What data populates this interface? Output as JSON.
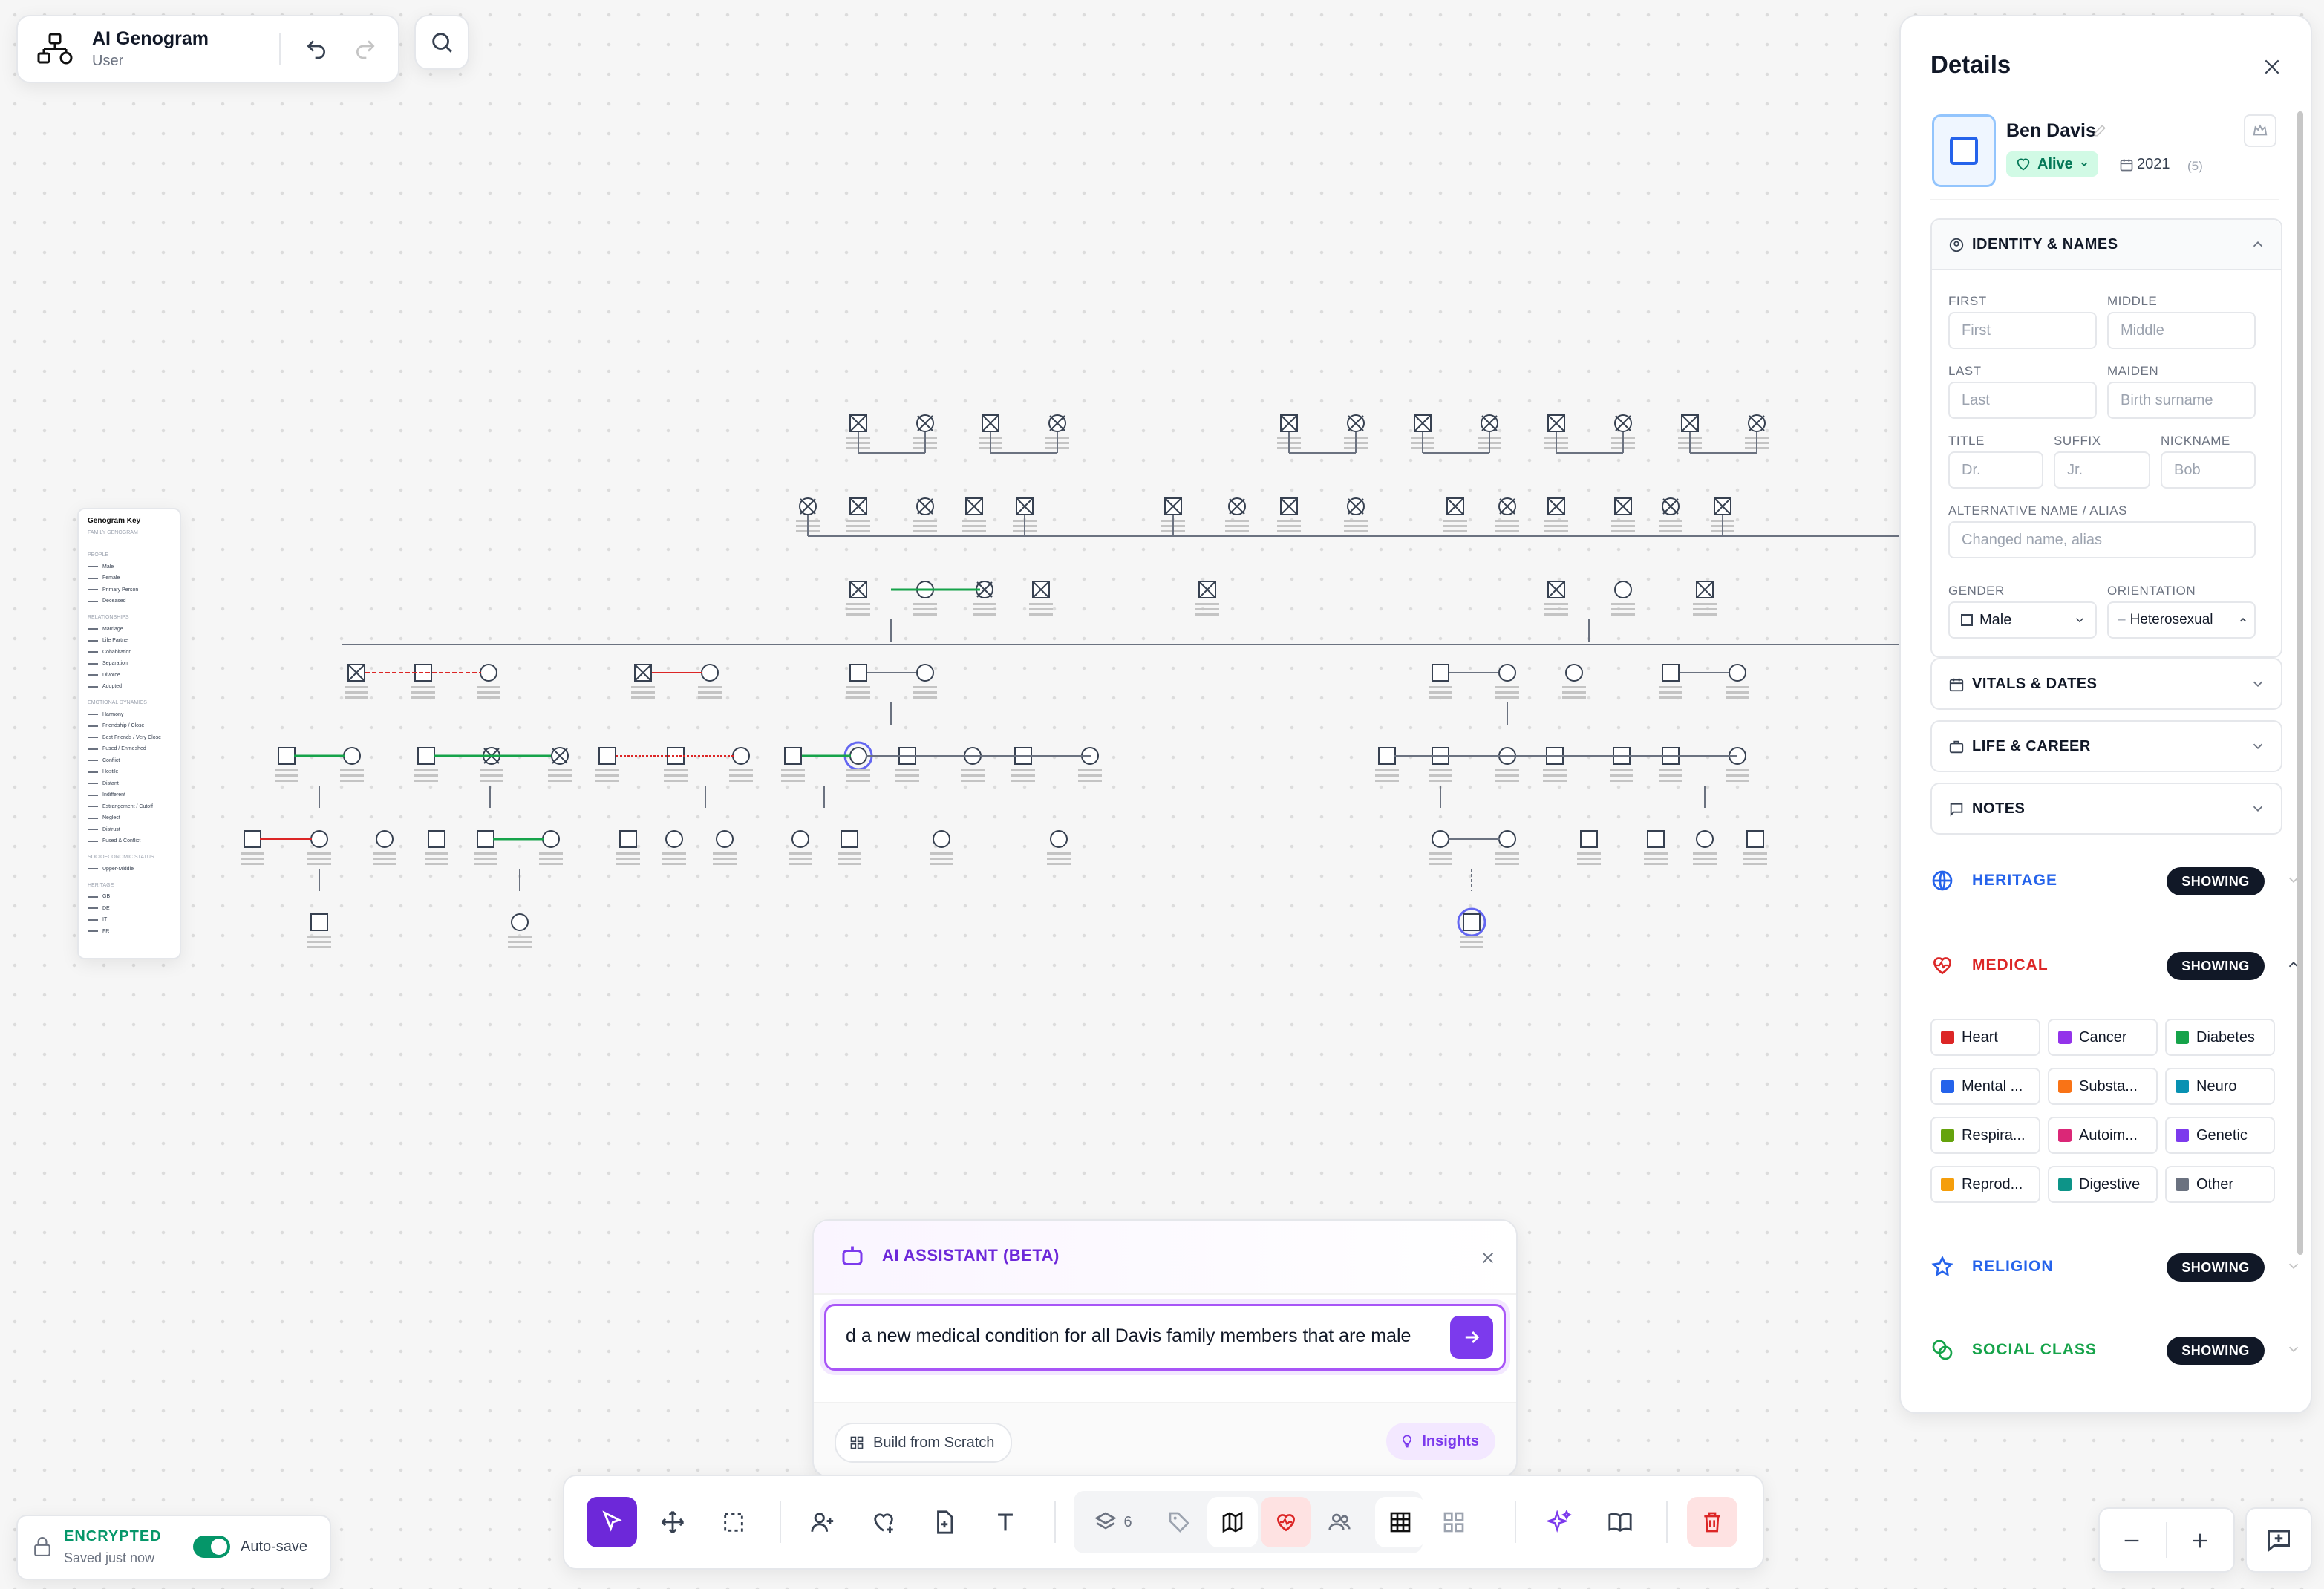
{
  "app": {
    "title": "AI Genogram",
    "subtitle": "User"
  },
  "key": {
    "title": "Genogram Key",
    "sections": [
      "FAMILY GENOGRAM",
      "PEOPLE",
      "RELATIONSHIPS",
      "EMOTIONAL DYNAMICS",
      "SOCIOECONOMIC STATUS",
      "HERITAGE"
    ],
    "people": [
      "Male",
      "Female",
      "Primary Person",
      "Deceased"
    ],
    "relationships": [
      "Marriage",
      "Life Partner",
      "Cohabitation",
      "Separation",
      "Divorce",
      "Adopted"
    ],
    "emotional": [
      "Harmony",
      "Friendship / Close",
      "Best Friends / Very Close",
      "Fused / Enmeshed",
      "Conflict",
      "Hostile",
      "Distant",
      "Indifferent",
      "Estrangement / Cutoff",
      "Neglect",
      "Distrust",
      "Fused & Conflict"
    ],
    "socio": [
      "Upper-Middle"
    ],
    "heritage": [
      "GB",
      "DE",
      "IT",
      "FR"
    ]
  },
  "details": {
    "title": "Details",
    "person": {
      "name": "Ben Davis",
      "status": "Alive",
      "year": "2021",
      "age": "(5)"
    },
    "identity": {
      "title": "IDENTITY & NAMES",
      "first_label": "FIRST",
      "first_ph": "First",
      "middle_label": "MIDDLE",
      "middle_ph": "Middle",
      "last_label": "LAST",
      "last_ph": "Last",
      "maiden_label": "MAIDEN",
      "maiden_ph": "Birth surname",
      "title_label": "TITLE",
      "title_ph": "Dr.",
      "suffix_label": "SUFFIX",
      "suffix_ph": "Jr.",
      "nickname_label": "NICKNAME",
      "nickname_ph": "Bob",
      "alt_label": "ALTERNATIVE NAME / ALIAS",
      "alt_ph": "Changed name, alias",
      "gender_label": "GENDER",
      "gender_value": "Male",
      "orientation_label": "ORIENTATION",
      "orientation_value": "Heterosexual"
    },
    "vitals": "VITALS & DATES",
    "life": "LIFE & CAREER",
    "notes": "NOTES",
    "heritage": {
      "label": "HERITAGE",
      "badge": "SHOWING"
    },
    "medical": {
      "label": "MEDICAL",
      "badge": "SHOWING"
    },
    "religion": {
      "label": "RELIGION",
      "badge": "SHOWING"
    },
    "social": {
      "label": "SOCIAL CLASS",
      "badge": "SHOWING"
    },
    "conditions": [
      {
        "label": "Heart",
        "color": "#dc2626"
      },
      {
        "label": "Cancer",
        "color": "#9333ea"
      },
      {
        "label": "Diabetes",
        "color": "#16a34a"
      },
      {
        "label": "Mental ...",
        "color": "#2563eb"
      },
      {
        "label": "Substa...",
        "color": "#f97316"
      },
      {
        "label": "Neuro",
        "color": "#0891b2"
      },
      {
        "label": "Respira...",
        "color": "#65a30d"
      },
      {
        "label": "Autoim...",
        "color": "#db2777"
      },
      {
        "label": "Genetic",
        "color": "#7c3aed"
      },
      {
        "label": "Reprod...",
        "color": "#f59e0b"
      },
      {
        "label": "Digestive",
        "color": "#0d9488"
      },
      {
        "label": "Other",
        "color": "#6b7280"
      }
    ]
  },
  "assistant": {
    "title": "AI ASSISTANT (BETA)",
    "input_text": "d a new medical condition for all Davis family members that are male",
    "build_label": "Build from Scratch",
    "insights_label": "Insights"
  },
  "toolbar": {
    "layers_count": "6"
  },
  "status": {
    "encrypted": "ENCRYPTED",
    "saved": "Saved just now",
    "autosave": "Auto-save"
  },
  "colors": {
    "accent": "#7c3aed",
    "medical": "#dc2626",
    "heritage": "#2563eb",
    "religion": "#2563eb",
    "social": "#16a34a",
    "ok": "#059669"
  }
}
